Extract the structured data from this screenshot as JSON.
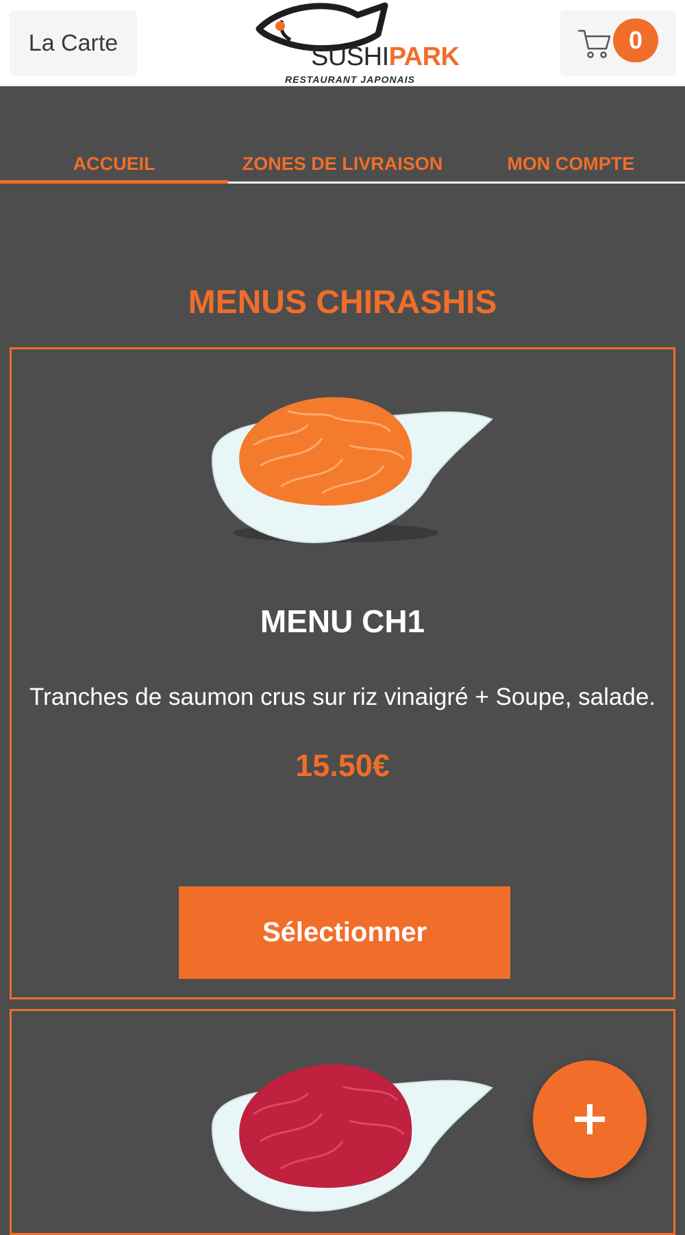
{
  "header": {
    "menu_button_label": "La Carte",
    "logo": {
      "word_main": "SUSHI",
      "word_accent": "PARK",
      "subtitle": "RESTAURANT JAPONAIS"
    },
    "cart_count": "0"
  },
  "nav": {
    "tabs": [
      {
        "label": "ACCUEIL",
        "active": true
      },
      {
        "label": "ZONES DE LIVRAISON",
        "active": false
      },
      {
        "label": "MON COMPTE",
        "active": false
      }
    ]
  },
  "section": {
    "title": "MENUS CHIRASHIS"
  },
  "items": [
    {
      "name": "MENU CH1",
      "description": "Tranches de saumon crus sur riz vinaigré + Soupe, salade.",
      "price": "15.50€",
      "button_label": "Sélectionner",
      "image": "salmon-chirashi-bowl"
    },
    {
      "image": "tuna-chirashi-bowl"
    }
  ],
  "fab": {
    "icon": "plus-icon"
  },
  "colors": {
    "accent": "#f06e2a",
    "background": "#4d4d4d",
    "header": "#ffffff"
  }
}
